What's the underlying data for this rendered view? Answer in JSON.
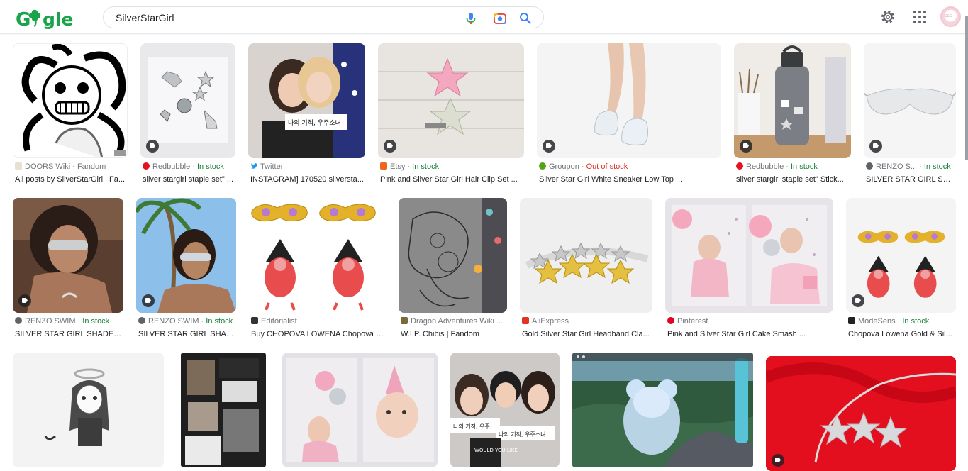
{
  "header": {
    "logo_text": "Gagle",
    "search_query": "SilverStarGirl",
    "avatar_text": "SSG"
  },
  "results": [
    {
      "source": "DOORS Wiki - Fandom",
      "stock": "",
      "title": "All posts by SilverStarGirl | Fa..."
    },
    {
      "source": "Redbubble · ",
      "stock": "In stock",
      "title": "silver stargirl staple set\" ..."
    },
    {
      "source": "Twitter",
      "stock": "",
      "title": "INSTAGRAM] 170520 silversta..."
    },
    {
      "source": "Etsy · ",
      "stock": "In stock",
      "title": "Pink and Silver Star Girl Hair Clip Set ..."
    },
    {
      "source": "Groupon · ",
      "stock": "Out of stock",
      "title": "Silver Star Girl White Sneaker Low Top ..."
    },
    {
      "source": "Redbubble · ",
      "stock": "In stock",
      "title": "silver stargirl staple set\" Stick..."
    },
    {
      "source": "RENZO S... · ",
      "stock": "In stock",
      "title": "SILVER STAR GIRL SHA..."
    },
    {
      "source": "RENZO SWIM · ",
      "stock": "In stock",
      "title": "SILVER STAR GIRL SHADES ..."
    },
    {
      "source": "RENZO SWIM · ",
      "stock": "In stock",
      "title": "SILVER STAR GIRL SHAD..."
    },
    {
      "source": "Editorialist",
      "stock": "",
      "title": "Buy CHOPOVA LOWENA Chopova L..."
    },
    {
      "source": "Dragon Adventures Wiki ...",
      "stock": "",
      "title": "W.I.P. Chibis | Fandom"
    },
    {
      "source": "AliExpress",
      "stock": "",
      "title": "Gold Silver Star Girl Headband Cla..."
    },
    {
      "source": "Pinterest",
      "stock": "",
      "title": "Pink and Silver Star Girl Cake Smash ..."
    },
    {
      "source": "ModeSens · ",
      "stock": "In stock",
      "title": "Chopova Lowena Gold & Sil..."
    }
  ],
  "thumb_text": {
    "sign1": "나의 기적, 우주소녀",
    "sign2": "나의 기적, 우주",
    "sign3": "WOULD YOU LIKE"
  },
  "colors": {
    "in_stock": "#188038",
    "out_of_stock": "#d93025",
    "source_gray": "#70757a",
    "search_blue": "#4285f4"
  }
}
